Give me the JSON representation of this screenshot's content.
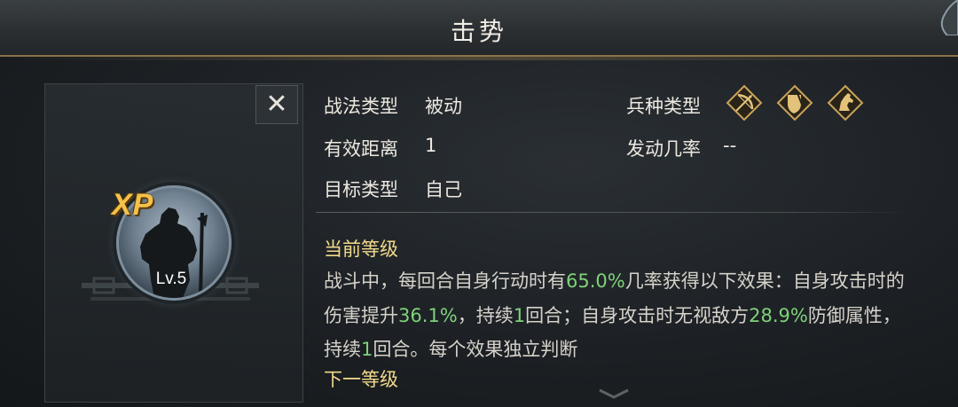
{
  "header": {
    "title": "击势"
  },
  "portrait": {
    "xp_label": "XP",
    "level_label": "Lv.5",
    "close_glyph": "✕"
  },
  "info": {
    "tactic_type_label": "战法类型",
    "tactic_type_value": "被动",
    "range_label": "有效距离",
    "range_value": "1",
    "target_label": "目标类型",
    "target_value": "自己",
    "troop_type_label": "兵种类型",
    "troop_icons": [
      "bow-icon",
      "shield-icon",
      "horse-icon"
    ],
    "trigger_rate_label": "发动几率",
    "trigger_rate_value": "--"
  },
  "current_level": {
    "heading": "当前等级",
    "desc_parts": [
      {
        "t": "战斗中，每回合自身行动时有",
        "hl": false
      },
      {
        "t": "65.0%",
        "hl": true
      },
      {
        "t": "几率获得以下效果：自身攻击时的伤害提升",
        "hl": false
      },
      {
        "t": "36.1%",
        "hl": true
      },
      {
        "t": "，持续",
        "hl": false
      },
      {
        "t": "1",
        "hl": true
      },
      {
        "t": "回合；自身攻击时无视敌方",
        "hl": false
      },
      {
        "t": "28.9%",
        "hl": true
      },
      {
        "t": "防御属性，持续",
        "hl": false
      },
      {
        "t": "1",
        "hl": true
      },
      {
        "t": "回合。每个效果独立判断",
        "hl": false
      }
    ]
  },
  "next_level": {
    "heading": "下一等级"
  },
  "colors": {
    "highlight": "#7fd27a",
    "heading": "#f2d98a",
    "accent_gold": "#c9a35a"
  }
}
